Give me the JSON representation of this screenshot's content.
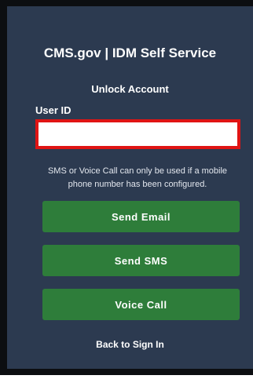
{
  "header": {
    "title": "CMS.gov | IDM Self Service",
    "subtitle": "Unlock Account"
  },
  "form": {
    "user_id_label": "User ID",
    "user_id_value": "",
    "note": "SMS or Voice Call can only be used if a mobile phone number has been configured."
  },
  "actions": {
    "send_email": "Send Email",
    "send_sms": "Send SMS",
    "voice_call": "Voice Call",
    "back_to_sign_in": "Back to Sign In"
  },
  "colors": {
    "panel_background": "#2c3a50",
    "button_green": "#2e7d3a",
    "input_border_highlight": "#e01414"
  }
}
